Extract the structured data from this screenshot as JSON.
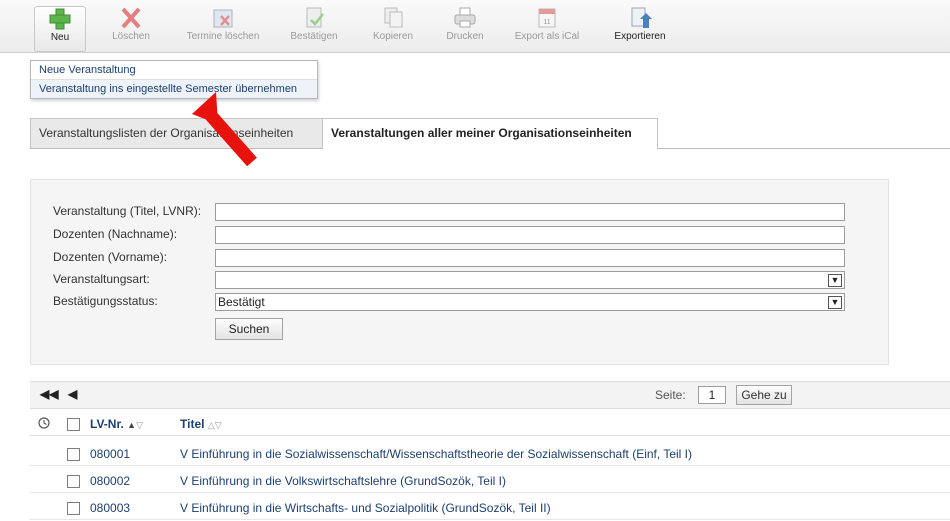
{
  "toolbar": {
    "buttons": [
      {
        "label": "Neu"
      },
      {
        "label": "Löschen"
      },
      {
        "label": "Termine löschen"
      },
      {
        "label": "Bestätigen"
      },
      {
        "label": "Kopieren"
      },
      {
        "label": "Drucken"
      },
      {
        "label": "Export als iCal"
      },
      {
        "label": "Exportieren"
      }
    ]
  },
  "new_menu": {
    "items": [
      {
        "label": "Neue Veranstaltung"
      },
      {
        "label": "Veranstaltung ins eingestellte Semester übernehmen"
      }
    ]
  },
  "tabs": [
    {
      "label": "Veranstaltungslisten der Organisationseinheiten"
    },
    {
      "label": "Veranstaltungen aller meiner Organisationseinheiten"
    }
  ],
  "search": {
    "fields": [
      {
        "label": "Veranstaltung (Titel, LVNR):",
        "value": ""
      },
      {
        "label": "Dozenten (Nachname):",
        "value": ""
      },
      {
        "label": "Dozenten (Vorname):",
        "value": ""
      },
      {
        "label": "Veranstaltungsart:",
        "value": ""
      },
      {
        "label": "Bestätigungsstatus:",
        "value": "Bestätigt"
      }
    ],
    "submit_label": "Suchen"
  },
  "pager": {
    "first_icon": "first-page-icon",
    "prev_icon": "previous-page-icon",
    "page_label": "Seite:",
    "page_value": "1",
    "go_label": "Gehe zu"
  },
  "table": {
    "columns": [
      "LV-Nr.",
      "Titel"
    ],
    "rows": [
      {
        "nr": "080001",
        "title": "V Einführung in die Sozialwissenschaft/Wissenschaftstheorie der Sozialwissenschaft (Einf, Teil I)"
      },
      {
        "nr": "080002",
        "title": "V Einführung in die Volkswirtschaftslehre (GrundSozök, Teil I)"
      },
      {
        "nr": "080003",
        "title": "V Einführung in die Wirtschafts- und Sozialpolitik (GrundSozök, Teil II)"
      }
    ]
  },
  "colors": {
    "link": "#1c3f6e",
    "highlight_arrow": "#e8120c",
    "panel_bg": "#f5f5f5"
  }
}
